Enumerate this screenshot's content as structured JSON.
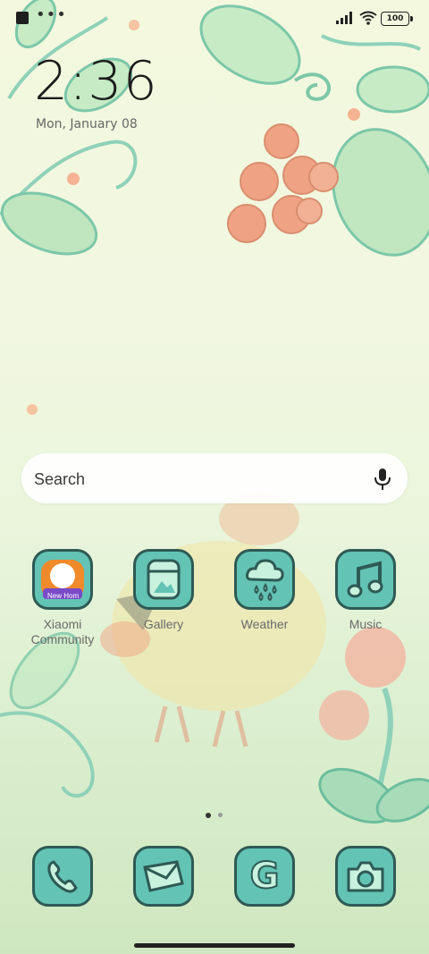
{
  "status_bar": {
    "battery": "100"
  },
  "lockscreen": {
    "time": "2:36",
    "date": "Mon, January 08"
  },
  "search": {
    "placeholder": "Search"
  },
  "apps": [
    {
      "label": "Xiaomi Community",
      "icon": "xiaomi-community-icon",
      "badge": "New Hom"
    },
    {
      "label": "Gallery",
      "icon": "gallery-icon"
    },
    {
      "label": "Weather",
      "icon": "weather-icon"
    },
    {
      "label": "Music",
      "icon": "music-icon"
    }
  ],
  "dock": [
    {
      "icon": "phone-icon"
    },
    {
      "icon": "messages-icon"
    },
    {
      "icon": "google-icon",
      "glyph": "G"
    },
    {
      "icon": "camera-icon"
    }
  ],
  "page_indicator": {
    "pages": 2,
    "active": 1
  },
  "colors": {
    "icon_fill": "#63c3b4",
    "icon_outline": "#2e5a55",
    "accent": "#c8f2de"
  }
}
